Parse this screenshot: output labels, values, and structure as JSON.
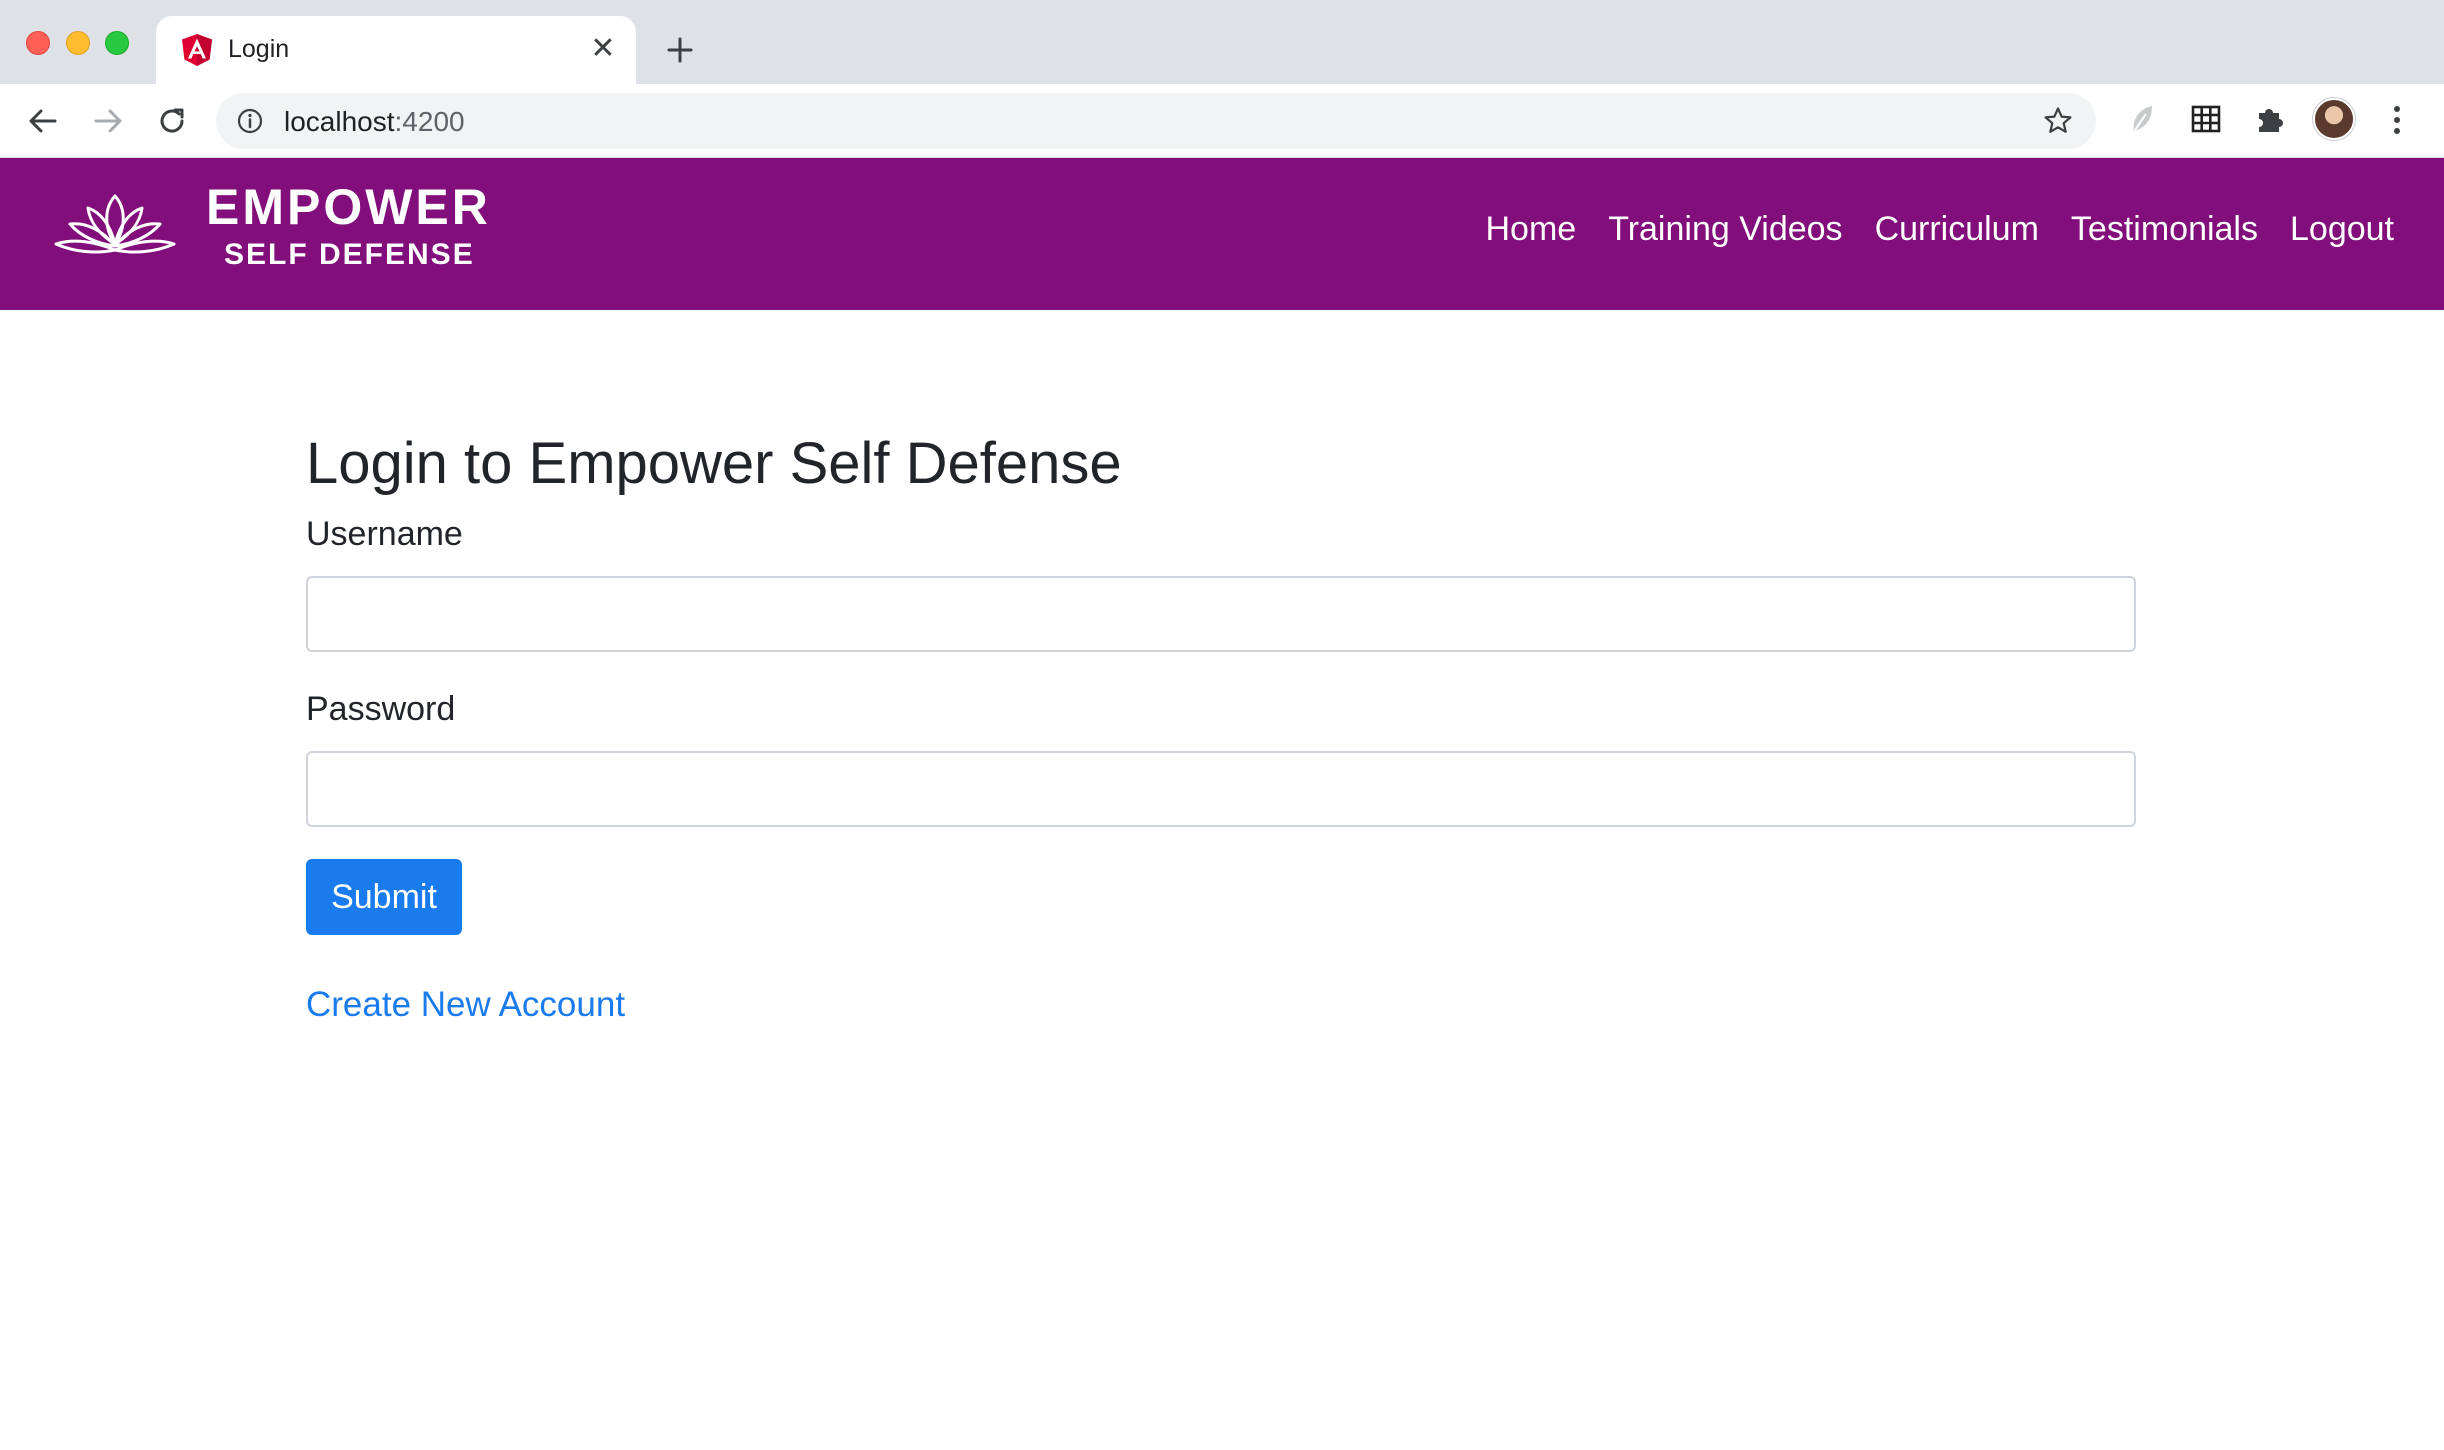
{
  "browser": {
    "tab_title": "Login",
    "tab_favicon": "angular-icon",
    "url_host": "localhost",
    "url_port": ":4200"
  },
  "site": {
    "logo_line1": "EMPOWER",
    "logo_line2": "SELF DEFENSE",
    "nav": [
      "Home",
      "Training Videos",
      "Curriculum",
      "Testimonials",
      "Logout"
    ]
  },
  "login": {
    "title": "Login to Empower Self Defense",
    "username_label": "Username",
    "username_value": "",
    "password_label": "Password",
    "password_value": "",
    "submit_label": "Submit",
    "create_account_label": "Create New Account"
  },
  "colors": {
    "brand": "#810e7b",
    "accent": "#1a7bef"
  }
}
